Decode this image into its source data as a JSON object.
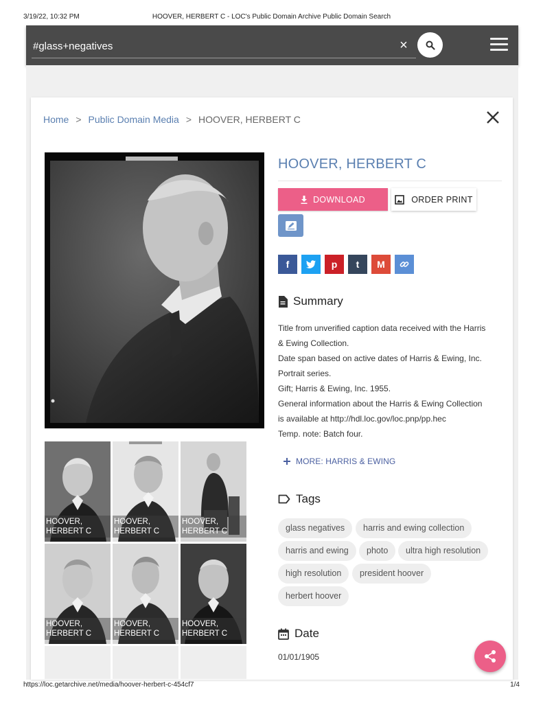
{
  "print": {
    "datetime": "3/19/22, 10:32 PM",
    "doc_title": "HOOVER, HERBERT C - LOC's Public Domain Archive Public Domain Search",
    "url": "https://loc.getarchive.net/media/hoover-herbert-c-454cf7",
    "page": "1/4"
  },
  "search": {
    "value": "#glass+negatives",
    "clear_label": "×"
  },
  "breadcrumb": {
    "home": "Home",
    "section": "Public Domain Media",
    "current": "HOOVER, HERBERT C",
    "separator": ">"
  },
  "item": {
    "title": "HOOVER, HERBERT C",
    "download_label": "DOWNLOAD",
    "order_label": "ORDER PRINT"
  },
  "share": [
    {
      "icon": "facebook-icon",
      "glyph": "f",
      "color": "#3b5998"
    },
    {
      "icon": "twitter-icon",
      "glyph": "t",
      "color": "#1da1f2"
    },
    {
      "icon": "pinterest-icon",
      "glyph": "p",
      "color": "#cb2027"
    },
    {
      "icon": "tumblr-icon",
      "glyph": "t",
      "color": "#35465c"
    },
    {
      "icon": "gmail-icon",
      "glyph": "M",
      "color": "#dd4b39"
    },
    {
      "icon": "link-icon",
      "glyph": "⚭",
      "color": "#5b8fd6"
    }
  ],
  "summary": {
    "heading": "Summary",
    "lines": [
      "Title from unverified caption data received with the Harris",
      "& Ewing Collection.",
      "Date span based on active dates of Harris & Ewing, Inc.",
      "Portrait series.",
      "Gift; Harris & Ewing, Inc. 1955.",
      "General information about the Harris & Ewing Collection",
      "is available at http://hdl.loc.gov/loc.pnp/pp.hec",
      "Temp. note: Batch four."
    ],
    "more_label": "MORE: HARRIS & EWING"
  },
  "tags": {
    "heading": "Tags",
    "items": [
      "glass negatives",
      "harris and ewing collection",
      "harris and ewing",
      "photo",
      "ultra high resolution",
      "high resolution",
      "president hoover",
      "herbert hoover"
    ]
  },
  "date": {
    "heading": "Date",
    "value": "01/01/1905"
  },
  "thumbnails": [
    {
      "line1": "HOOVER,",
      "line2": "HERBERT C"
    },
    {
      "line1": "HOOVER,",
      "line2": "HERBERT C"
    },
    {
      "line1": "HOOVER,",
      "line2": "HERBERT C"
    },
    {
      "line1": "HOOVER,",
      "line2": "HERBERT C"
    },
    {
      "line1": "HOOVER,",
      "line2": "HERBERT C"
    },
    {
      "line1": "HOOVER,",
      "line2": "HERBERT C"
    }
  ],
  "colors": {
    "accent_pink": "#ec5f88",
    "link_blue": "#5a7fb0",
    "topbar": "#4a4a4a"
  }
}
